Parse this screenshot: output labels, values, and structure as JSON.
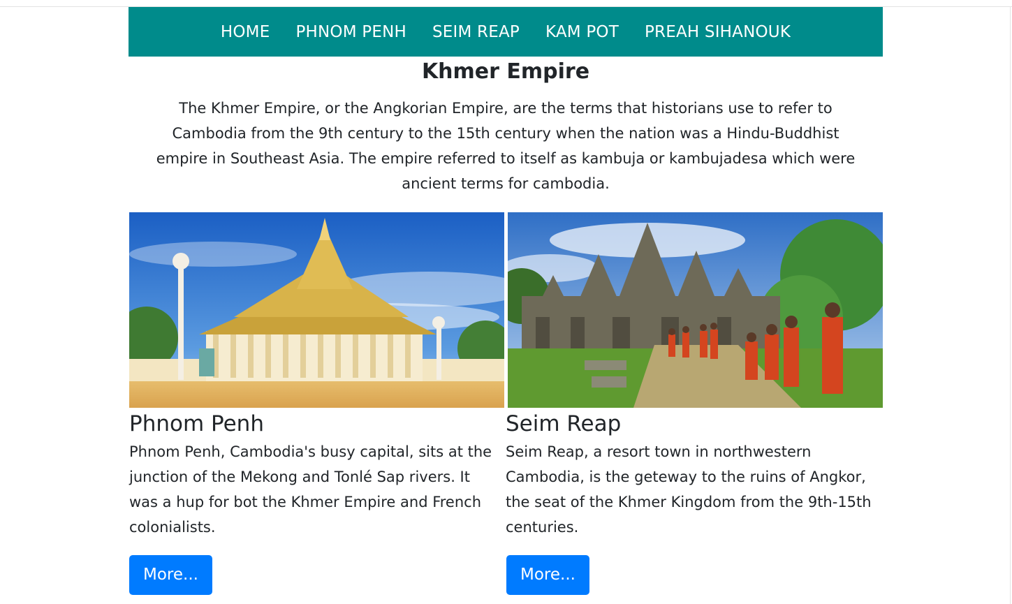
{
  "nav": {
    "items": [
      {
        "label": "HOME"
      },
      {
        "label": "PHNOM PENH"
      },
      {
        "label": "SEIM REAP"
      },
      {
        "label": "KAM POT"
      },
      {
        "label": "PREAH SIHANOUK"
      }
    ],
    "background": "#008b8b"
  },
  "main": {
    "title": "Khmer Empire",
    "intro": "The Khmer Empire, or the Angkorian Empire, are the terms that historians use to refer to Cambodia from the 9th century to the 15th century when the nation was a Hindu-Buddhist empire in Southeast Asia. The empire referred to itself as kambuja or kambujadesa which were ancient terms for cambodia."
  },
  "cards": [
    {
      "title": "Phnom Penh",
      "text": "Phnom Penh, Cambodia's busy capital, sits at the junction of the Mekong and Tonlé Sap rivers. It was a hup for bot the Khmer Empire and French colonialists.",
      "button": "More...",
      "image": "royal-palace-photo"
    },
    {
      "title": "Seim Reap",
      "text": "Seim Reap, a resort town in northwestern Cambodia, is the geteway to the ruins of Angkor, the seat of the Khmer Kingdom from the 9th-15th centuries.",
      "button": "More...",
      "image": "angkor-temple-monks-photo"
    }
  ],
  "colors": {
    "button": "#007bff",
    "text": "#212529"
  }
}
